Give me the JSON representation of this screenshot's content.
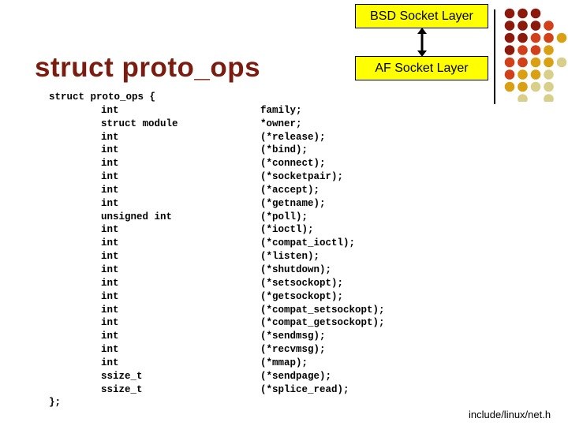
{
  "title": "struct proto_ops",
  "diagram": {
    "top_box": "BSD Socket Layer",
    "bottom_box": "AF Socket Layer",
    "box_color": "#ffff00",
    "arrow": "bidirectional"
  },
  "code": {
    "open": "struct proto_ops {",
    "members": [
      {
        "type": "int",
        "name": "family;"
      },
      {
        "type": "struct module",
        "name": "*owner;"
      },
      {
        "type": "int",
        "name": "(*release);"
      },
      {
        "type": "int",
        "name": "(*bind);"
      },
      {
        "type": "int",
        "name": "(*connect);"
      },
      {
        "type": "int",
        "name": "(*socketpair);"
      },
      {
        "type": "int",
        "name": "(*accept);"
      },
      {
        "type": "int",
        "name": "(*getname);"
      },
      {
        "type": "unsigned int",
        "name": "(*poll);"
      },
      {
        "type": "int",
        "name": "(*ioctl);"
      },
      {
        "type": "int",
        "name": "(*compat_ioctl);"
      },
      {
        "type": "int",
        "name": "(*listen);"
      },
      {
        "type": "int",
        "name": "(*shutdown);"
      },
      {
        "type": "int",
        "name": "(*setsockopt);"
      },
      {
        "type": "int",
        "name": "(*getsockopt);"
      },
      {
        "type": "int",
        "name": "(*compat_setsockopt);"
      },
      {
        "type": "int",
        "name": "(*compat_getsockopt);"
      },
      {
        "type": "int",
        "name": "(*sendmsg);"
      },
      {
        "type": "int",
        "name": "(*recvmsg);"
      },
      {
        "type": "int",
        "name": "(*mmap);"
      },
      {
        "type": "ssize_t",
        "name": "(*sendpage);"
      },
      {
        "type": "ssize_t",
        "name": "(*splice_read);"
      }
    ],
    "close": "};"
  },
  "footer": "include/linux/net.h",
  "decoration": {
    "dot_palette": [
      "#8b1a0c",
      "#d2401a",
      "#d9a014",
      "#d8d08a"
    ],
    "dot_rows": [
      [
        0,
        0,
        0,
        null,
        null
      ],
      [
        0,
        0,
        0,
        1,
        null
      ],
      [
        0,
        0,
        1,
        1,
        2
      ],
      [
        0,
        1,
        1,
        2,
        null
      ],
      [
        1,
        1,
        2,
        2,
        3
      ],
      [
        1,
        2,
        2,
        3,
        null
      ],
      [
        2,
        2,
        3,
        3,
        null
      ],
      [
        null,
        3,
        null,
        3,
        null
      ]
    ]
  }
}
